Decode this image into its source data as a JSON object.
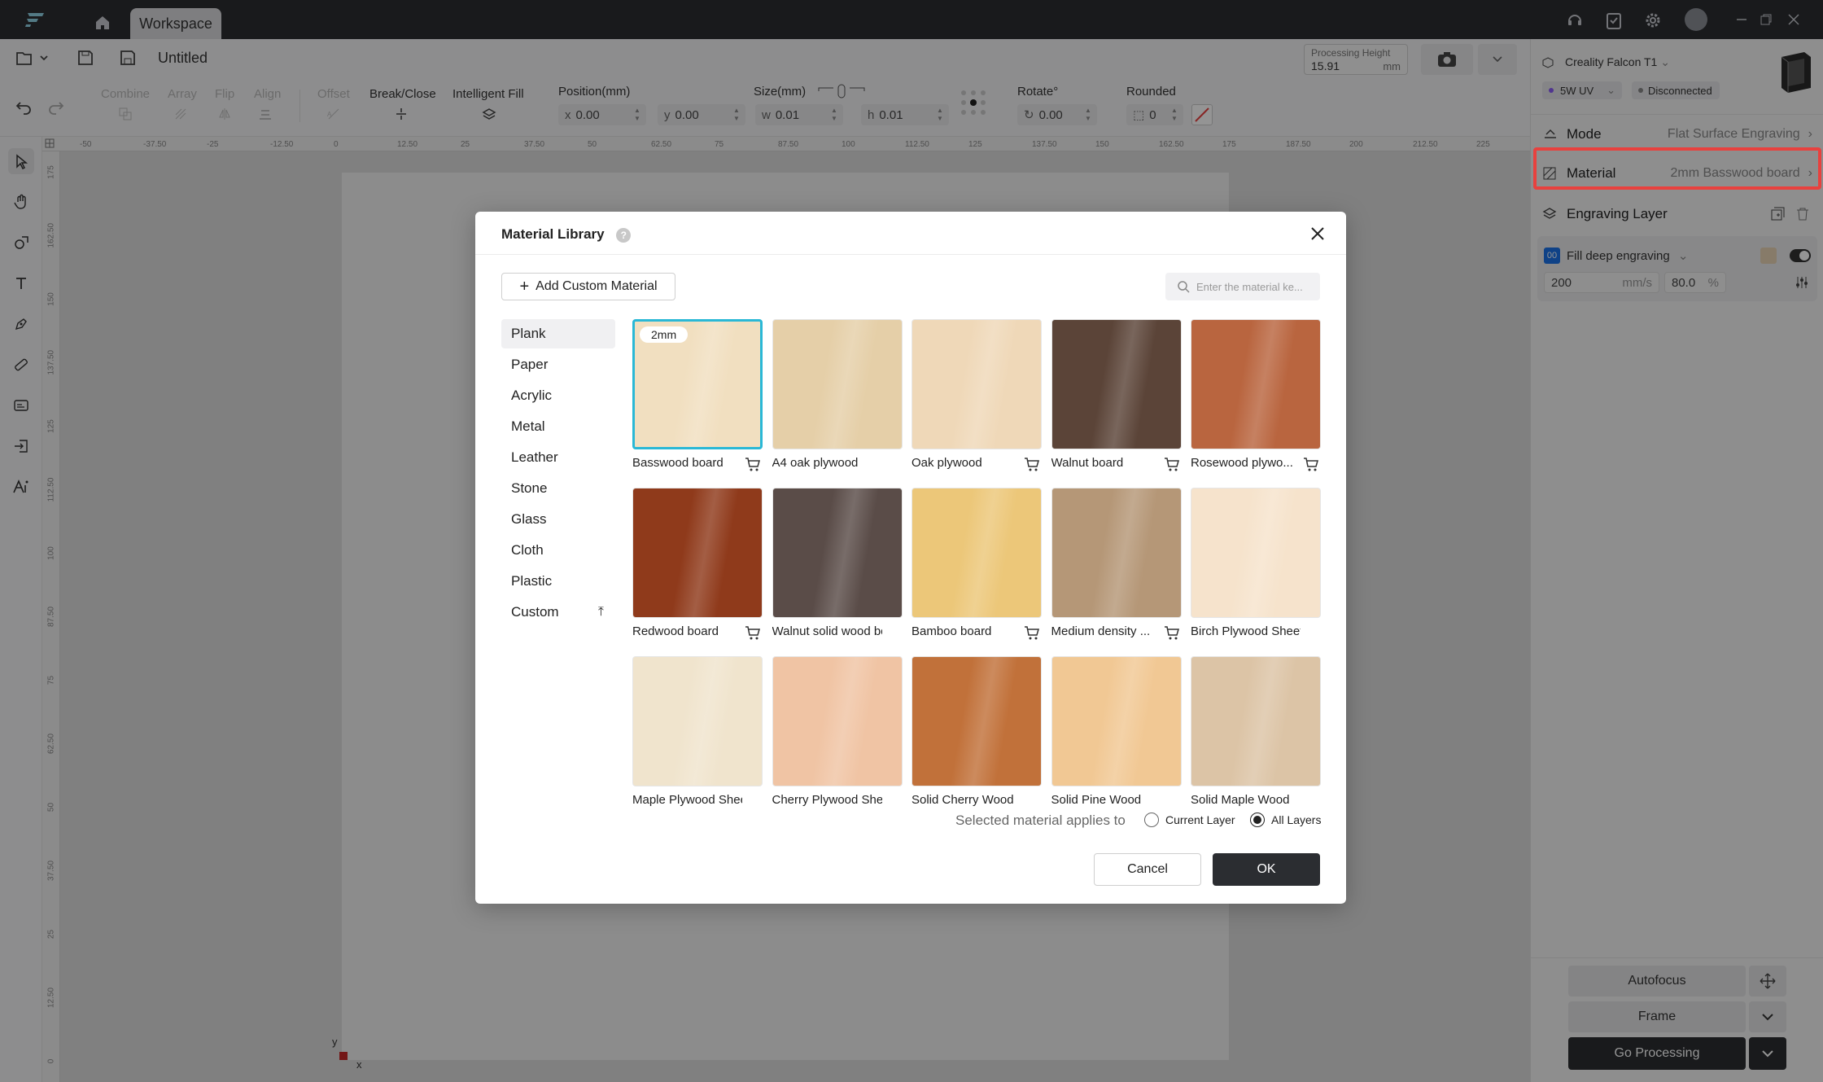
{
  "titlebar": {
    "tab_label": "Workspace"
  },
  "file": {
    "name": "Untitled"
  },
  "toolbar": {
    "combine": "Combine",
    "array": "Array",
    "flip": "Flip",
    "align": "Align",
    "offset": "Offset",
    "break_close": "Break/Close",
    "intelligent_fill": "Intelligent Fill",
    "position_label": "Position(mm)",
    "size_label": "Size(mm)",
    "rotate_label": "Rotate°",
    "rounded_label": "Rounded",
    "x_prefix": "x",
    "x_value": "0.00",
    "y_prefix": "y",
    "y_value": "0.00",
    "w_prefix": "w",
    "w_value": "0.01",
    "h_prefix": "h",
    "h_value": "0.01",
    "rotate_value": "0.00",
    "rounded_value": "0",
    "processing_height_label": "Processing Height",
    "processing_height_value": "15.91",
    "processing_height_unit": "mm"
  },
  "ruler_top": [
    "-50",
    "-37.50",
    "-25",
    "-12.50",
    "0",
    "12.50",
    "25",
    "37.50",
    "50",
    "62.50",
    "75",
    "87.50",
    "100",
    "112.50",
    "125",
    "137.50",
    "150",
    "162.50",
    "175",
    "187.50",
    "200",
    "212.50",
    "225"
  ],
  "ruler_left": [
    "175",
    "162.50",
    "150",
    "137.50",
    "125",
    "112.50",
    "100",
    "87.50",
    "75",
    "62.50",
    "50",
    "37.50",
    "25",
    "12.50",
    "0"
  ],
  "axis": {
    "x": "x",
    "y": "y"
  },
  "right_panel": {
    "device_name": "Creality Falcon T1",
    "laser": "5W UV",
    "status": "Disconnected",
    "mode_label": "Mode",
    "mode_value": "Flat Surface Engraving",
    "material_label": "Material",
    "material_value": "2mm Basswood board",
    "engraving_layer_label": "Engraving Layer",
    "layer_number": "00",
    "layer_name": "Fill deep engraving",
    "speed_value": "200",
    "speed_unit": "mm/s",
    "power_value": "80.0",
    "power_unit": "%",
    "autofocus": "Autofocus",
    "frame": "Frame",
    "go_processing": "Go Processing"
  },
  "dialog": {
    "title": "Material Library",
    "add_custom": "Add Custom Material",
    "search_placeholder": "Enter the material ke...",
    "categories": [
      "Plank",
      "Paper",
      "Acrylic",
      "Metal",
      "Leather",
      "Stone",
      "Glass",
      "Cloth",
      "Plastic",
      "Custom"
    ],
    "selected_badge": "2mm",
    "materials": [
      {
        "name": "Basswood board",
        "cart": true,
        "color": "#f1dfc0"
      },
      {
        "name": "A4 oak plywood",
        "cart": false,
        "color": "#e5cfa8"
      },
      {
        "name": "Oak plywood",
        "cart": true,
        "color": "#efd8b8"
      },
      {
        "name": "Walnut board",
        "cart": true,
        "color": "#5b4438"
      },
      {
        "name": "Rosewood plywo...",
        "cart": true,
        "color": "#b9653f"
      },
      {
        "name": "Redwood board",
        "cart": true,
        "color": "#8f3a1b"
      },
      {
        "name": "Walnut solid wood bo...",
        "cart": false,
        "color": "#5a4c48"
      },
      {
        "name": "Bamboo board",
        "cart": true,
        "color": "#ecc779"
      },
      {
        "name": "Medium density ...",
        "cart": true,
        "color": "#b59777"
      },
      {
        "name": "Birch Plywood Sheets",
        "cart": false,
        "color": "#f6e3cc"
      },
      {
        "name": "Maple Plywood Sheets",
        "cart": false,
        "color": "#f0e4cd"
      },
      {
        "name": "Cherry Plywood Sheets",
        "cart": false,
        "color": "#f0c4a4"
      },
      {
        "name": "Solid Cherry Wood",
        "cart": false,
        "color": "#c1713a"
      },
      {
        "name": "Solid Pine Wood",
        "cart": false,
        "color": "#f1c894"
      },
      {
        "name": "Solid Maple Wood",
        "cart": false,
        "color": "#dcc4a6"
      }
    ],
    "applies_to_label": "Selected material applies to",
    "option_current": "Current Layer",
    "option_all": "All Layers",
    "cancel": "Cancel",
    "ok": "OK"
  },
  "colors": {
    "accent": "#2ab8d6",
    "highlight": "#e8413e",
    "dark_button": "#2b2d31"
  }
}
